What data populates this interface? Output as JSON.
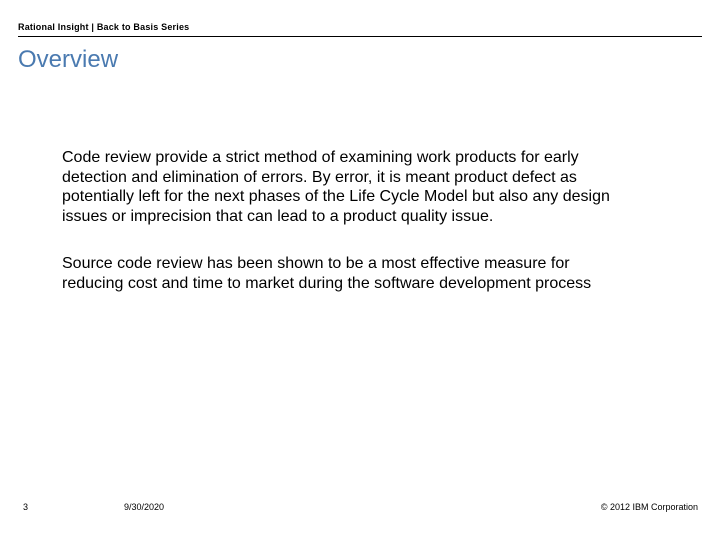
{
  "header": "Rational Insight | Back to Basis Series",
  "title": "Overview",
  "paragraphs": [
    "Code review provide a strict method of examining work products for early detection and elimination of errors. By error, it is meant product defect as potentially left for the next phases of the Life Cycle Model but also any design issues or imprecision that can lead to a product quality issue.",
    "Source code review has been shown to be a most effective measure for reducing cost and time to market during the software development process"
  ],
  "footer": {
    "page_number": "3",
    "date": "9/30/2020",
    "copyright": "© 2012 IBM Corporation"
  }
}
